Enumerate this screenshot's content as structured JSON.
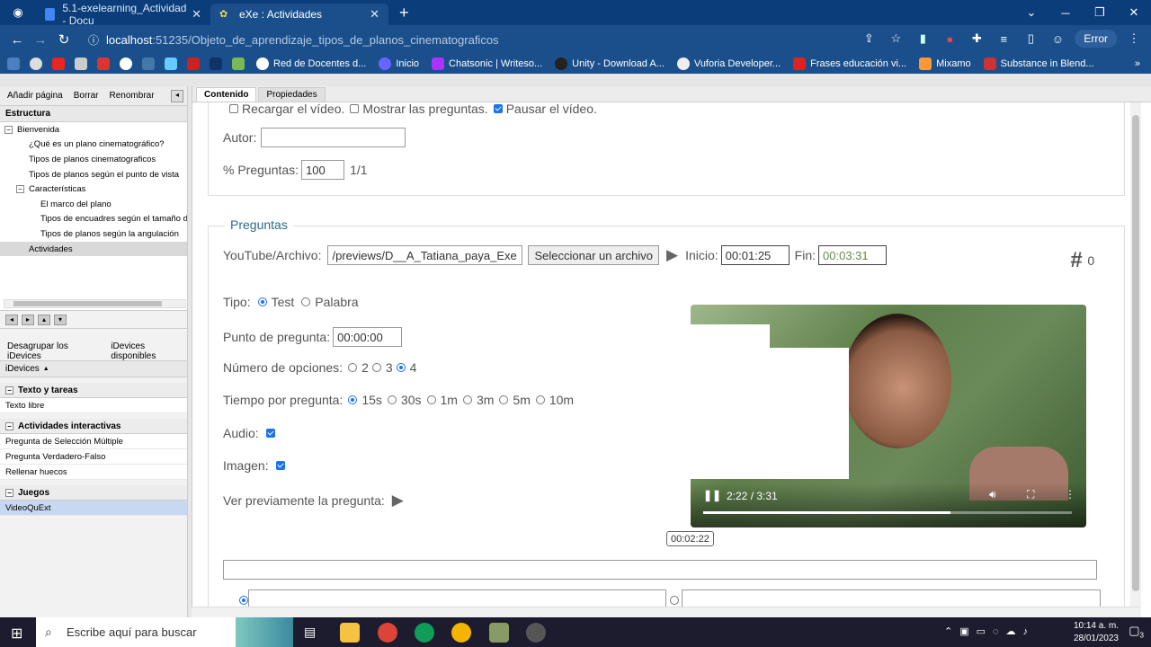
{
  "browser": {
    "tabs": [
      {
        "title": "5.1-exelearning_Actividad - Docu",
        "close": "✕"
      },
      {
        "title": "eXe : Actividades",
        "close": "✕"
      }
    ],
    "new_tab": "+",
    "url_host": "localhost",
    "url_path": ":51235/Objeto_de_aprendizaje_tipos_de_planos_cinematograficos",
    "error_label": "Error",
    "bookmarks": [
      "Red de Docentes d...",
      "Inicio",
      "Chatsonic | Writeso...",
      "Unity - Download A...",
      "Vuforia Developer...",
      "Frases educación vi...",
      "Mixamo",
      "Substance in Blend..."
    ],
    "bookmarks_more": "»"
  },
  "left": {
    "tools": [
      "Añadir página",
      "Borrar",
      "Renombrar"
    ],
    "structure_title": "Estructura",
    "tree": [
      {
        "label": "Bienvenida",
        "level": 0,
        "toggle": "−"
      },
      {
        "label": "¿Qué es un plano cinematográfico?",
        "level": 1
      },
      {
        "label": "Tipos de planos cinematograficos",
        "level": 1
      },
      {
        "label": "Tipos de planos según el punto de vista",
        "level": 1
      },
      {
        "label": "Características",
        "level": 1,
        "toggle": "−"
      },
      {
        "label": "El marco del plano",
        "level": 2
      },
      {
        "label": "Tipos de encuadres según el tamaño del",
        "level": 2
      },
      {
        "label": "Tipos de planos según la angulación",
        "level": 2
      },
      {
        "label": "Actividades",
        "level": 1,
        "selected": true
      }
    ],
    "idevice_tabs": [
      "Desagrupar los iDevices",
      "iDevices disponibles"
    ],
    "idevices_label": "iDevices",
    "sections": [
      {
        "title": "Texto y tareas",
        "items": [
          "Texto libre"
        ]
      },
      {
        "title": "Actividades interactivas",
        "items": [
          "Pregunta de Selección Múltiple",
          "Pregunta Verdadero-Falso",
          "Rellenar huecos"
        ]
      },
      {
        "title": "Juegos",
        "items": [
          "VideoQuExt"
        ]
      }
    ]
  },
  "right": {
    "tabs": [
      "Contenido",
      "Propiedades"
    ],
    "options_line": {
      "reload": "Recargar el vídeo.",
      "show": "Mostrar las preguntas.",
      "pause": "Pausar el vídeo."
    },
    "author_label": "Autor:",
    "author_value": "",
    "percent_label": "% Preguntas:",
    "percent_value": "100",
    "percent_count": "1/1",
    "questions_legend": "Preguntas",
    "youtube_label": "YouTube/Archivo:",
    "youtube_value": "/previews/D__A_Tatiana_paya_Exe",
    "select_file": "Seleccionar un archivo",
    "start_label": "Inicio:",
    "start_value": "00:01:25",
    "end_label": "Fin:",
    "end_value": "00:03:31",
    "hash_symbol": "#",
    "hash_count": "0",
    "type_label": "Tipo:",
    "type_options": [
      "Test",
      "Palabra"
    ],
    "question_point_label": "Punto de pregunta:",
    "question_point_value": "00:00:00",
    "num_options_label": "Número de opciones:",
    "num_options": [
      "2",
      "3",
      "4"
    ],
    "time_label": "Tiempo por pregunta:",
    "time_options": [
      "15s",
      "30s",
      "1m",
      "3m",
      "5m",
      "10m"
    ],
    "audio_label": "Audio:",
    "image_label": "Imagen:",
    "preview_label": "Ver previamente la pregunta:",
    "video_time": "2:22 / 3:31",
    "video_progress": 0.67,
    "video_stamp": "00:02:22"
  },
  "taskbar": {
    "search_placeholder": "Escribe aquí para buscar",
    "time": "10:14 a. m.",
    "date": "28/01/2023",
    "notif": "3"
  }
}
